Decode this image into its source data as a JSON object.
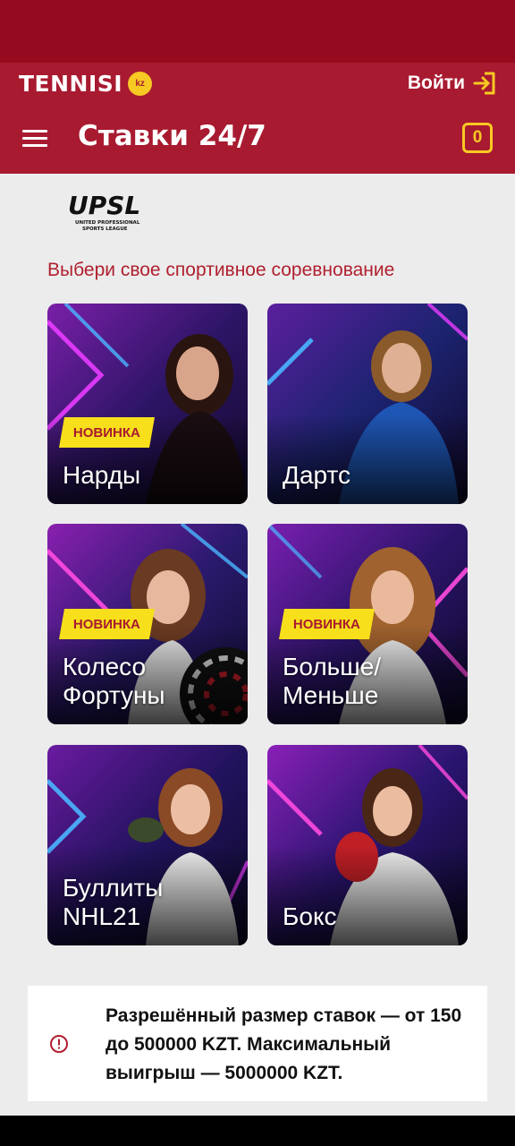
{
  "header": {
    "brand": "TENNISI",
    "brand_badge": "kz",
    "login_label": "Войти",
    "page_title": "Ставки 24/7",
    "betslip_count": "0"
  },
  "logo": {
    "title": "UPSL",
    "line1": "UNITED PROFESSIONAL",
    "line2": "SPORTS LEAGUE"
  },
  "section_heading": "Выбери свое спортивное соревнование",
  "badge_label": "НОВИНКА",
  "games": [
    {
      "label": "Нарды",
      "is_new": true
    },
    {
      "label": "Дартс",
      "is_new": false
    },
    {
      "label": "Колесо\nФортуны",
      "is_new": true
    },
    {
      "label": "Больше/\nМеньше",
      "is_new": true
    },
    {
      "label": "Буллиты\nNHL21",
      "is_new": false
    },
    {
      "label": "Бокс",
      "is_new": false
    }
  ],
  "notice": {
    "text": "Разрешённый размер ставок — от 150 до 500000 KZT. Максимальный выигрыш — 5000000 KZT."
  },
  "colors": {
    "status_bar": "#950a1e",
    "header": "#a81a30",
    "accent_yellow": "#f7c923",
    "badge_yellow": "#f7e01b",
    "heading_red": "#b0202f",
    "page_bg": "#ececec"
  }
}
